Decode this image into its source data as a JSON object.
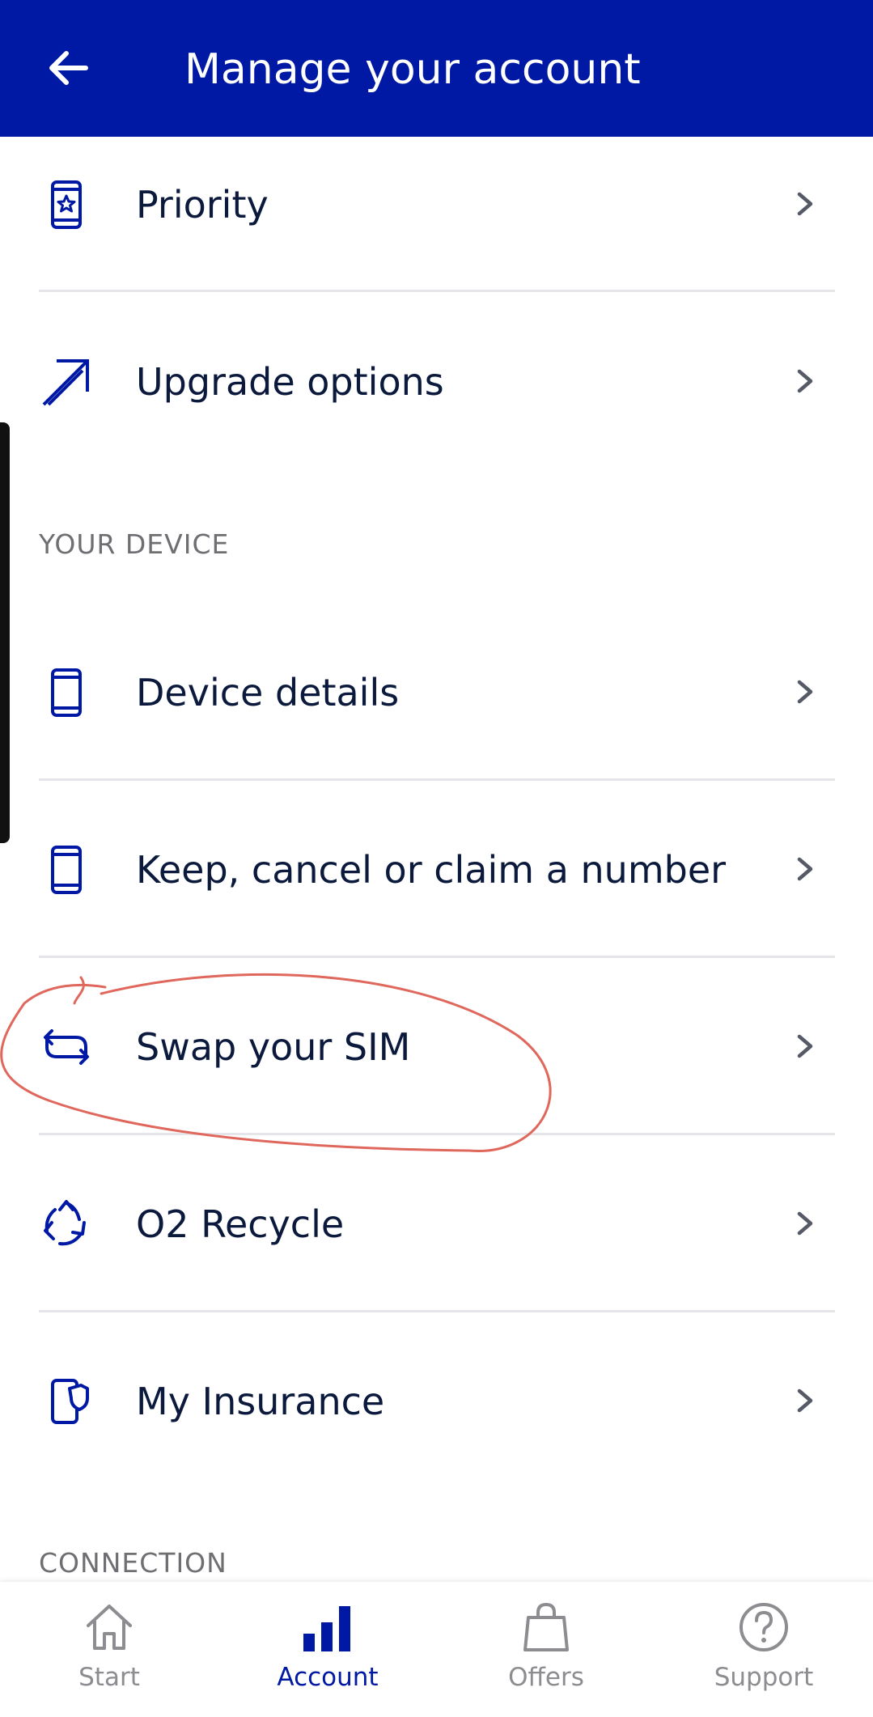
{
  "header": {
    "title": "Manage your account"
  },
  "sections": {
    "device": "YOUR DEVICE",
    "connection": "CONNECTION"
  },
  "menu": [
    {
      "label": "Priority",
      "icon": "phone-star-icon"
    },
    {
      "label": "Upgrade options",
      "icon": "arrow-up-right-icon"
    },
    {
      "label": "Device details",
      "icon": "phone-icon"
    },
    {
      "label": "Keep, cancel or claim a number",
      "icon": "phone-icon"
    },
    {
      "label": "Swap your SIM",
      "icon": "swap-icon"
    },
    {
      "label": "O2 Recycle",
      "icon": "recycle-icon"
    },
    {
      "label": "My Insurance",
      "icon": "insurance-icon"
    }
  ],
  "tabs": [
    {
      "label": "Start",
      "icon": "home-icon",
      "active": false
    },
    {
      "label": "Account",
      "icon": "bar-chart-icon",
      "active": true
    },
    {
      "label": "Offers",
      "icon": "bag-icon",
      "active": false
    },
    {
      "label": "Support",
      "icon": "help-icon",
      "active": false
    }
  ],
  "colors": {
    "brand": "#0019a5",
    "text": "#0b1a3c",
    "muted": "#6e6e73",
    "annotation": "#e0675c"
  }
}
